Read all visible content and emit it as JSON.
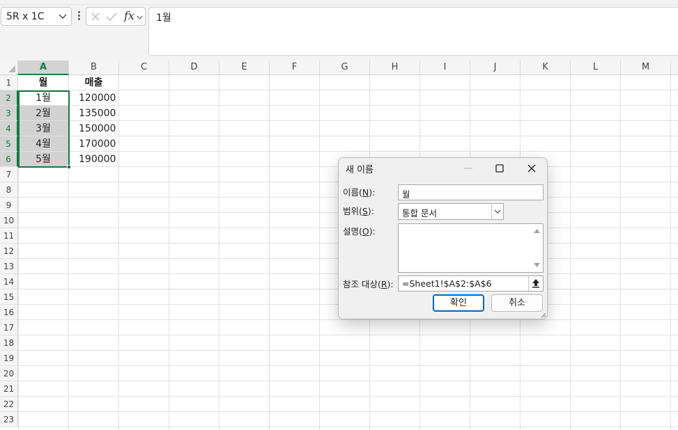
{
  "formula_bar": {
    "name_box": "5R x 1C",
    "fx_label": "fx",
    "formula_text": "1월"
  },
  "columns": [
    "A",
    "B",
    "C",
    "D",
    "E",
    "F",
    "G",
    "H",
    "I",
    "J",
    "K",
    "L",
    "M"
  ],
  "rows": [
    "1",
    "2",
    "3",
    "4",
    "5",
    "6",
    "7",
    "8",
    "9",
    "10",
    "11",
    "12",
    "13",
    "14",
    "15",
    "16",
    "17",
    "18",
    "19",
    "20",
    "21",
    "22",
    "23"
  ],
  "sheet": {
    "header": {
      "a": "월",
      "b": "매출"
    },
    "data": [
      {
        "a": "1월",
        "b": "120000"
      },
      {
        "a": "2월",
        "b": "135000"
      },
      {
        "a": "3월",
        "b": "150000"
      },
      {
        "a": "4월",
        "b": "170000"
      },
      {
        "a": "5월",
        "b": "190000"
      }
    ]
  },
  "dialog": {
    "title": "새 이름",
    "name_label_pre": "이름(",
    "name_label_key": "N",
    "name_label_post": "):",
    "name_value": "월",
    "scope_label_pre": "범위(",
    "scope_label_key": "S",
    "scope_label_post": "):",
    "scope_value": "통합 문서",
    "comment_label_pre": "설명(",
    "comment_label_key": "O",
    "comment_label_post": "):",
    "comment_value": "",
    "ref_label_pre": "참조 대상(",
    "ref_label_key": "R",
    "ref_label_post": "):",
    "ref_value": "=Sheet1!$A$2:$A$6",
    "ok_label": "확인",
    "cancel_label": "취소"
  },
  "colors": {
    "accent": "#217346",
    "selection_fill": "#d2d2d2",
    "dialog_ok_border": "#0067c0"
  }
}
